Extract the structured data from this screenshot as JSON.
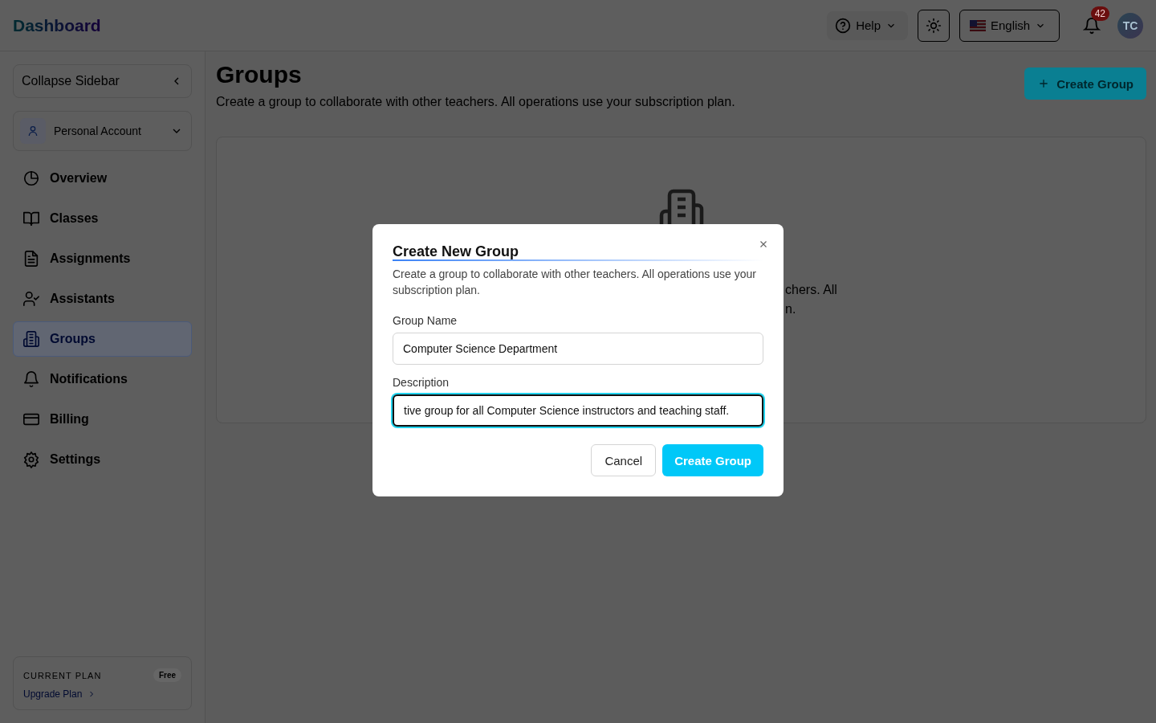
{
  "header": {
    "brand": "Dashboard",
    "help": "Help",
    "language": "English",
    "notification_count": "42",
    "avatar": "TC"
  },
  "sidebar": {
    "collapse": "Collapse Sidebar",
    "account": "Personal Account",
    "items": [
      {
        "label": "Overview",
        "selected": false
      },
      {
        "label": "Classes",
        "selected": false
      },
      {
        "label": "Assignments",
        "selected": false
      },
      {
        "label": "Assistants",
        "selected": false
      },
      {
        "label": "Groups",
        "selected": true
      },
      {
        "label": "Notifications",
        "selected": false
      },
      {
        "label": "Billing",
        "selected": false
      },
      {
        "label": "Settings",
        "selected": false
      }
    ],
    "plan": {
      "label": "CURRENT PLAN",
      "badge": "Free",
      "link": "Upgrade Plan"
    }
  },
  "page": {
    "title": "Groups",
    "subtitle": "Create a group to collaborate with other teachers. All operations use your subscription plan.",
    "create_button": "Create Group",
    "empty_state": {
      "text_fragments": [
        "chers. All",
        "n."
      ]
    }
  },
  "dialog": {
    "title": "Create New Group",
    "description": "Create a group to collaborate with other teachers. All operations use your subscription plan.",
    "fields": [
      {
        "label": "Group Name",
        "value": "Computer Science Department",
        "focused": false
      },
      {
        "label": "Description",
        "value": "tive group for all Computer Science instructors and teaching staff.",
        "focused": true
      }
    ],
    "cancel": "Cancel",
    "submit": "Create Group"
  }
}
